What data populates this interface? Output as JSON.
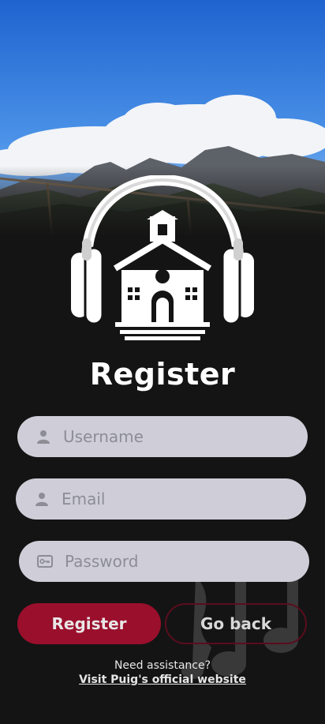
{
  "page": {
    "title": "Register"
  },
  "form": {
    "username_placeholder": "Username",
    "email_placeholder": "Email",
    "password_placeholder": "Password"
  },
  "actions": {
    "register_label": "Register",
    "back_label": "Go back"
  },
  "footer": {
    "assist_text": "Need assistance?",
    "link_text": "Visit Puig's official website"
  },
  "icons": {
    "logo": "school-headphones-logo",
    "username": "user-icon",
    "email": "user-icon",
    "password": "key-icon",
    "decoration": "music-notes-icon"
  },
  "colors": {
    "background": "#141414",
    "primary": "#9a0f2c",
    "field": "#cfced8"
  }
}
